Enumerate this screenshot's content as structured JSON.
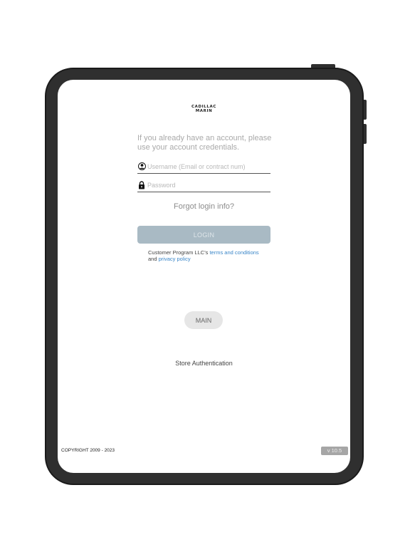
{
  "brand": {
    "line1": "CADILLAC",
    "line2": "MARIN"
  },
  "login": {
    "intro": "If you already have an account, please use your account credentials.",
    "username_placeholder": "Username (Email or contract num)",
    "password_placeholder": "Password",
    "forgot_label": "Forgot login info?",
    "login_label": "LOGIN"
  },
  "terms": {
    "prefix": "Customer Program LLC's",
    "terms_link": "terms and conditions",
    "middle": "and",
    "privacy_link": "privacy policy"
  },
  "main_button": "MAIN",
  "store_auth": "Store Authentication",
  "footer": {
    "copyright": "COPYRIGHT 2009 - 2023",
    "version": "v 10.5"
  },
  "colors": {
    "device_body": "#2f2f2f",
    "login_button": "#a9bac4",
    "link": "#3a86c8"
  },
  "icons": {
    "username": "user-icon",
    "password": "lock-icon"
  }
}
